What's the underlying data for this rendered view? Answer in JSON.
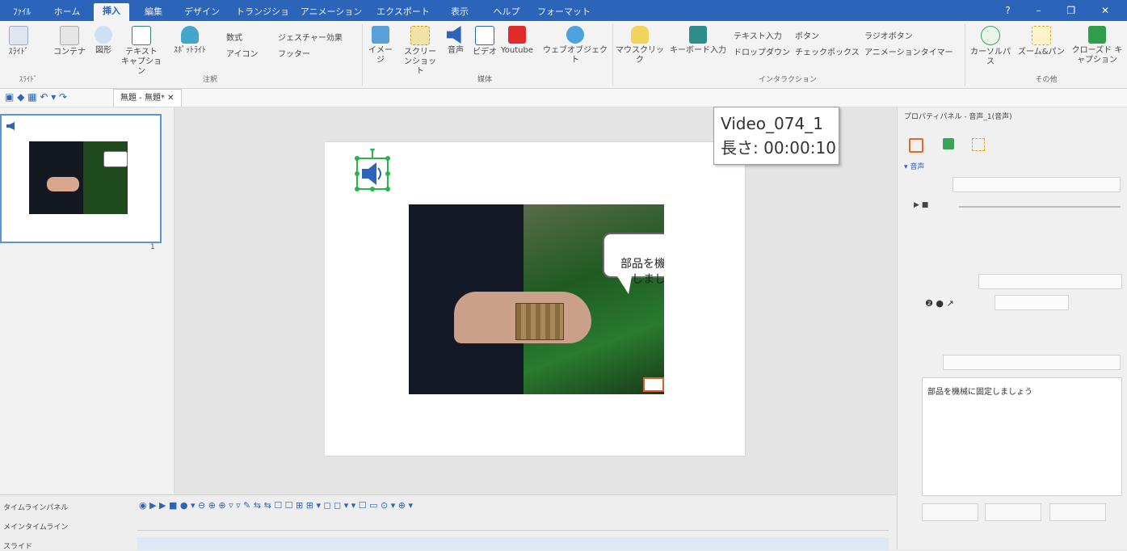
{
  "ribbon_tabs": [
    "ﾌｧｲﾙ",
    "ホーム",
    "挿入",
    "編集",
    "デザイン",
    "トランジション",
    "アニメーション",
    "エクスポート",
    "表示",
    "ヘルプ",
    "フォーマット"
  ],
  "active_tab": "挿入",
  "ribbon": {
    "buttons": [
      {
        "label": "ｽﾗｲﾄﾞ",
        "group": "ｽﾗｲﾄﾞ"
      },
      {
        "label": "コンテナ"
      },
      {
        "label": "図形"
      },
      {
        "label": "テキスト キャプション"
      },
      {
        "label": "ｽﾎﾟｯﾄﾗｲﾄ"
      },
      {
        "label": "イメージ"
      },
      {
        "label": "スクリーンショット"
      },
      {
        "label": "音声"
      },
      {
        "label": "ビデオ"
      },
      {
        "label": "Youtube"
      },
      {
        "label": "ウェブオブジェクト"
      },
      {
        "label": "マウスクリック"
      },
      {
        "label": "キーボード入力"
      },
      {
        "label": "カーソルパス"
      },
      {
        "label": "ズーム&パン"
      },
      {
        "label": "クローズド キャプション"
      }
    ],
    "small_items": [
      "数式",
      "ジェスチャー効果",
      "アイコン",
      "フッター",
      "テキスト入力",
      "ボタン",
      "ラジオボタン",
      "ドロップダウン",
      "チェックボックス",
      "アニメーションタイマー"
    ],
    "groups": [
      "ｽﾗｲﾄﾞ",
      "注釈",
      "媒体",
      "インタラクション",
      "その他"
    ]
  },
  "document_tab": "無題 - 無題*",
  "thumbnail": {
    "number": "1"
  },
  "slide": {
    "bubble_text": "部品を機械に固定\nしましょう！"
  },
  "tooltip": {
    "line1": "Video_074_1",
    "line2": "長さ: 00:00:10"
  },
  "properties": {
    "title": "プロパティパネル - 音声_1(音声)",
    "section": "音声",
    "textbox_value": "部品を機械に固定しましょう"
  },
  "timeline": {
    "title": "タイムラインパネル",
    "main": "メインタイムライン",
    "row": "スライド"
  },
  "colors": {
    "ribbon_blue": "#2b64b9",
    "selection_green": "#2bb24c",
    "bubble_border": "#6a6a6a"
  }
}
